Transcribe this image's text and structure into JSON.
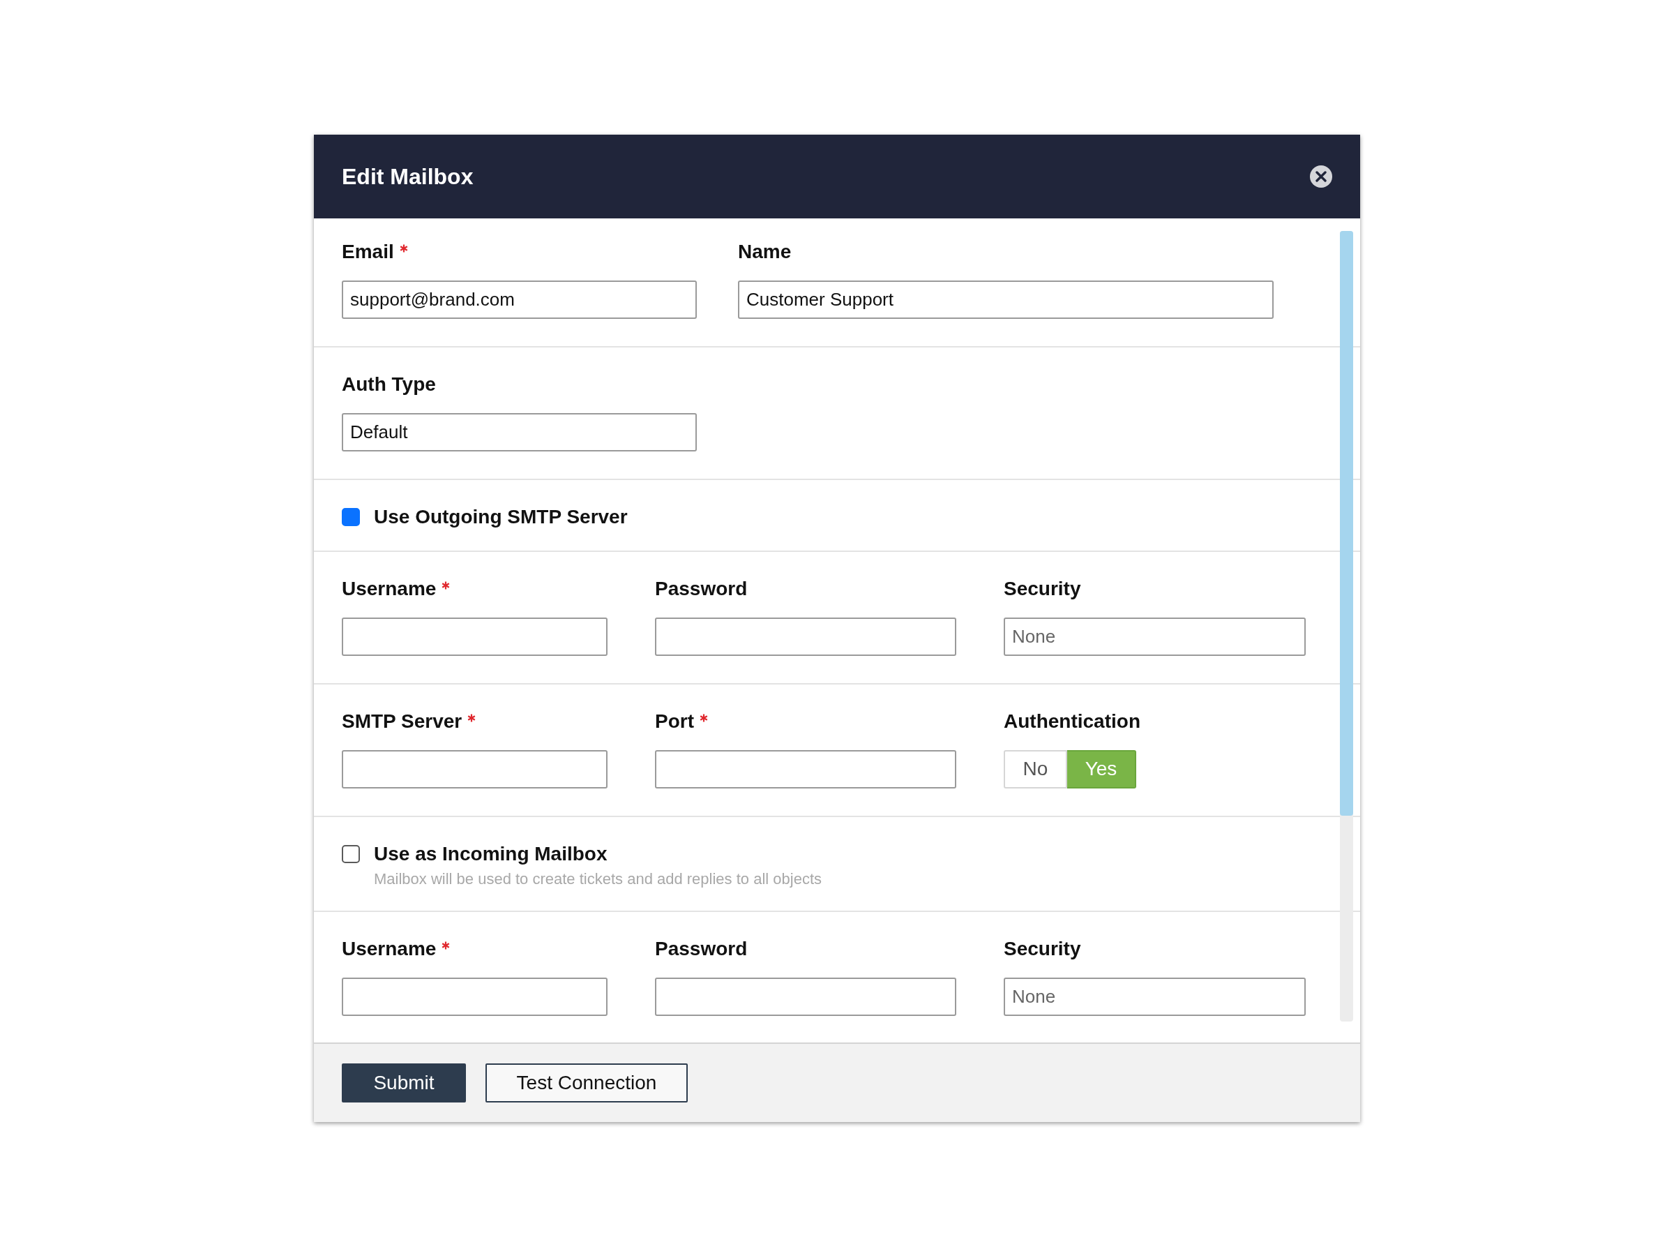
{
  "dialog": {
    "title": "Edit Mailbox"
  },
  "sections": [
    {
      "kind": "fields",
      "fields": [
        {
          "kind": "text",
          "label": "Email",
          "required": true,
          "value": "support@brand.com"
        },
        {
          "kind": "text",
          "label": "Name",
          "required": false,
          "value": "Customer Support"
        }
      ]
    },
    {
      "kind": "fields",
      "fields": [
        {
          "kind": "text",
          "label": "Auth Type",
          "required": false,
          "value": "Default"
        }
      ]
    },
    {
      "kind": "checkbox",
      "label": "Use Outgoing SMTP Server",
      "checked": true
    },
    {
      "kind": "fields",
      "fields": [
        {
          "kind": "text",
          "label": "Username",
          "required": true
        },
        {
          "kind": "text",
          "label": "Password",
          "required": false
        },
        {
          "kind": "text",
          "label": "Security",
          "required": false,
          "placeholder": "None"
        }
      ]
    },
    {
      "kind": "fields",
      "fields": [
        {
          "kind": "text",
          "label": "SMTP Server",
          "required": true
        },
        {
          "kind": "text",
          "label": "Port",
          "required": true
        },
        {
          "kind": "toggle",
          "label": "Authentication",
          "required": false,
          "options": [
            {
              "label": "No",
              "selected": false
            },
            {
              "label": "Yes",
              "selected": true
            }
          ]
        }
      ]
    },
    {
      "kind": "checkbox",
      "label": "Use as Incoming Mailbox",
      "checked": false,
      "description": "Mailbox will be used to create tickets and add replies to all objects"
    },
    {
      "kind": "fields",
      "fields": [
        {
          "kind": "text",
          "label": "Username",
          "required": true
        },
        {
          "kind": "text",
          "label": "Password",
          "required": false
        },
        {
          "kind": "text",
          "label": "Security",
          "required": false,
          "placeholder": "None"
        }
      ]
    }
  ],
  "footer": {
    "buttons": [
      {
        "kind": "primary",
        "label": "Submit"
      },
      {
        "kind": "secondary",
        "label": "Test Connection"
      }
    ]
  }
}
